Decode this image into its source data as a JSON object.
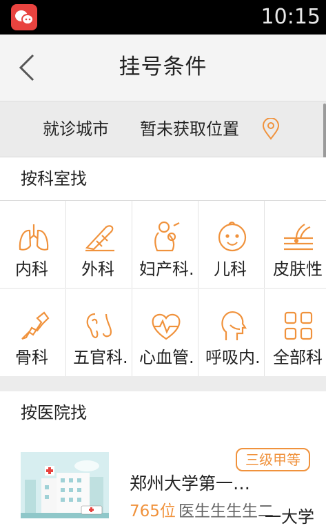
{
  "status_bar": {
    "time": "10:15"
  },
  "header": {
    "title": "挂号条件"
  },
  "city": {
    "label": "就诊城市",
    "value": "暂未获取位置"
  },
  "by_department": {
    "title": "按科室找",
    "departments": [
      {
        "label": "内科",
        "icon": "lungs-icon"
      },
      {
        "label": "外科",
        "icon": "scalpel-icon"
      },
      {
        "label": "妇产科.",
        "icon": "mother-baby-icon"
      },
      {
        "label": "儿科",
        "icon": "baby-face-icon"
      },
      {
        "label": "皮肤性",
        "icon": "skin-layer-icon"
      },
      {
        "label": "骨科",
        "icon": "bone-icon"
      },
      {
        "label": "五官科.",
        "icon": "ear-nose-icon"
      },
      {
        "label": "心血管.",
        "icon": "heart-pulse-icon"
      },
      {
        "label": "呼吸内.",
        "icon": "head-profile-icon"
      },
      {
        "label": "全部科",
        "icon": "grid-icon"
      }
    ]
  },
  "by_hospital": {
    "title": "按医院找",
    "hospital": {
      "name": "郑州大学第一…",
      "level": "三级甲等",
      "doctor_count": "765位",
      "doctor_suffix": "医生生生生二"
    }
  },
  "watermark": "一大学",
  "colors": {
    "accent": "#f0923c",
    "status_bar": "#000000",
    "app_icon": "#e8433f"
  }
}
